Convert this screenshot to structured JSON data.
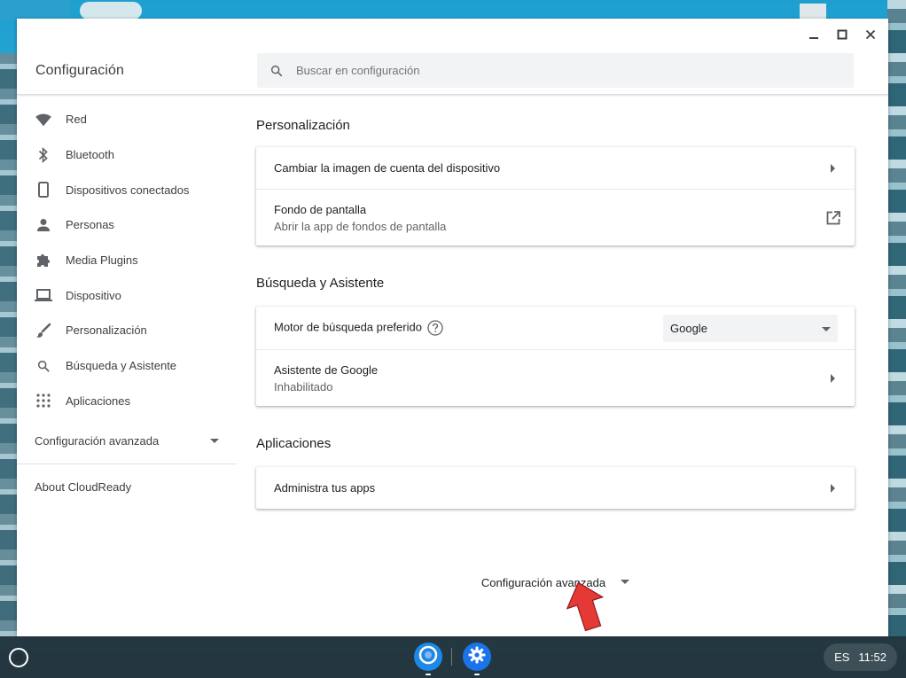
{
  "window": {
    "app_title": "Configuración",
    "search_placeholder": "Buscar en configuración"
  },
  "sidebar": {
    "items": [
      {
        "label": "Red",
        "icon": "wifi-icon"
      },
      {
        "label": "Bluetooth",
        "icon": "bluetooth-icon"
      },
      {
        "label": "Dispositivos conectados",
        "icon": "phone-icon"
      },
      {
        "label": "Personas",
        "icon": "person-icon"
      },
      {
        "label": "Media Plugins",
        "icon": "puzzle-icon"
      },
      {
        "label": "Dispositivo",
        "icon": "laptop-icon"
      },
      {
        "label": "Personalización",
        "icon": "brush-icon"
      },
      {
        "label": "Búsqueda y Asistente",
        "icon": "search-icon"
      },
      {
        "label": "Aplicaciones",
        "icon": "apps-grid-icon"
      }
    ],
    "advanced_label": "Configuración avanzada",
    "about_label": "About CloudReady"
  },
  "main": {
    "personalization": {
      "title": "Personalización",
      "change_image": "Cambiar la imagen de cuenta del dispositivo",
      "wallpaper_title": "Fondo de pantalla",
      "wallpaper_sub": "Abrir la app de fondos de pantalla"
    },
    "search_assistant": {
      "title": "Búsqueda y Asistente",
      "engine_label": "Motor de búsqueda preferido",
      "engine_value": "Google",
      "assistant_title": "Asistente de Google",
      "assistant_sub": "Inhabilitado"
    },
    "apps": {
      "title": "Aplicaciones",
      "manage": "Administra tus apps"
    },
    "advanced_label": "Configuración avanzada"
  },
  "shelf": {
    "ime": "ES",
    "time": "11:52"
  },
  "colors": {
    "accent": "#1a73e8",
    "icon_gray": "#5f6368",
    "annotation_red": "#e53935"
  }
}
